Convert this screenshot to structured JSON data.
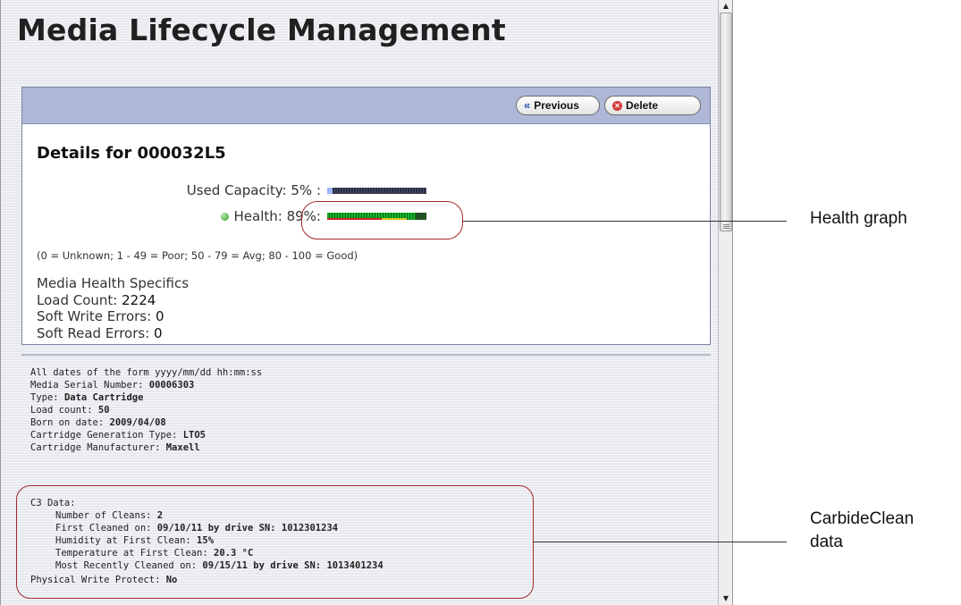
{
  "page": {
    "title": "Media Lifecycle Management"
  },
  "toolbar": {
    "previous_label": "Previous",
    "delete_label": "Delete",
    "icons": {
      "previous": "rewind-icon",
      "delete": "delete-icon"
    }
  },
  "details": {
    "heading": "Details for 000032L5",
    "used_capacity_label": "Used Capacity: 5% :",
    "used_capacity_percent": 5,
    "health_label": "Health: 89%:",
    "health_percent": 89,
    "health_status_color": "#4fb24a",
    "legend": "(0 = Unknown; 1 - 49 = Poor; 50 - 79 = Avg; 80 - 100 = Good)",
    "specifics_title": "Media Health Specifics",
    "load_count_label": "Load Count:",
    "load_count_value": "2224",
    "soft_write_label": "Soft Write Errors:",
    "soft_write_value": "0",
    "soft_read_label": "Soft Read Errors:",
    "soft_read_value": "0"
  },
  "cartridge": {
    "dates_note": "All dates of the form yyyy/mm/dd hh:mm:ss",
    "lines": [
      {
        "label": "Media Serial Number:",
        "value": "00006303"
      },
      {
        "label": "Type:",
        "value": "Data Cartridge"
      },
      {
        "label": "Load count:",
        "value": "50"
      },
      {
        "label": "Born on date:",
        "value": "2009/04/08"
      },
      {
        "label": "Cartridge Generation Type:",
        "value": "LTO5"
      },
      {
        "label": "Cartridge Manufacturer:",
        "value": "Maxell"
      }
    ],
    "c3_title": "C3 Data:",
    "c3_lines": [
      {
        "label": "Number of Cleans:",
        "value": "2"
      },
      {
        "label": "First Cleaned on:",
        "value": "09/10/11 by drive SN: 1012301234"
      },
      {
        "label": "Humidity at First Clean:",
        "value": "15%"
      },
      {
        "label": "Temperature at First Clean:",
        "value": "20.3 °C"
      },
      {
        "label": "Most Recently Cleaned on:",
        "value": "09/15/11 by drive SN: 1013401234"
      }
    ],
    "write_protect_label": "Physical Write Protect:",
    "write_protect_value": "No"
  },
  "callouts": {
    "health_graph": "Health graph",
    "carbide_line1": "CarbideClean",
    "carbide_line2": "data"
  },
  "colors": {
    "toolbar_bg": "#aeb8d6",
    "callout_outline": "#a32a2a",
    "health_bar_green": "#12b52a",
    "capacity_fill": "#9fb6ff"
  }
}
